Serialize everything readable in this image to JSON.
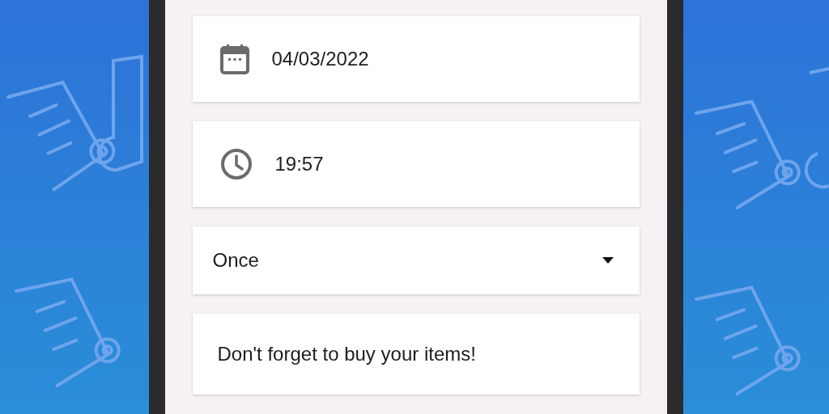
{
  "fields": [
    {
      "kind": "date",
      "value": "04/03/2022"
    },
    {
      "kind": "time",
      "value": "19:57"
    },
    {
      "kind": "dropdown",
      "value": "Once"
    },
    {
      "kind": "message",
      "value": "Don't forget to buy your items!"
    }
  ]
}
